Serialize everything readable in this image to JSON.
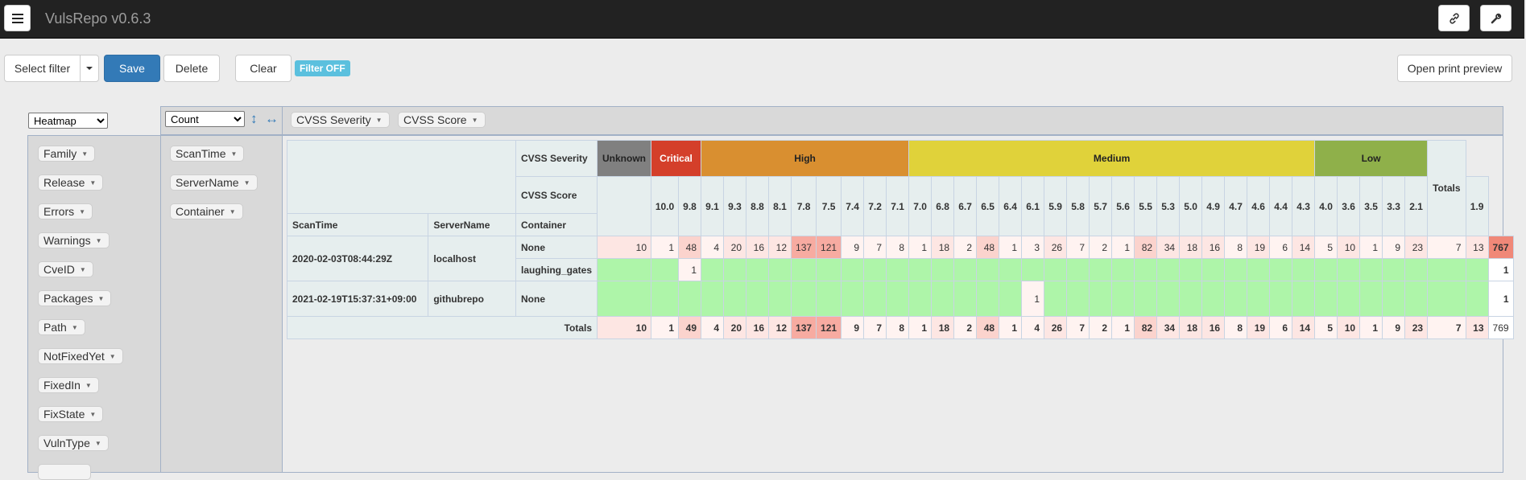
{
  "app": {
    "title": "VulsRepo v0.6.3"
  },
  "toolbar": {
    "select_filter": "Select filter",
    "save": "Save",
    "delete": "Delete",
    "clear": "Clear",
    "filter_status": "Filter OFF",
    "print_preview": "Open print preview"
  },
  "pivot": {
    "renderer": "Heatmap",
    "aggregator": "Count",
    "col_attrs": [
      "CVSS Severity",
      "CVSS Score"
    ],
    "unused_attrs": [
      "Family",
      "Release",
      "Errors",
      "Warnings",
      "CveID",
      "Packages",
      "Path",
      "NotFixedYet",
      "FixedIn",
      "FixState",
      "VulnType"
    ],
    "row_attrs": [
      "ScanTime",
      "ServerName",
      "Container"
    ]
  },
  "table": {
    "header_labels": {
      "cvss_severity": "CVSS Severity",
      "cvss_score": "CVSS Score",
      "totals": "Totals",
      "scan_time": "ScanTime",
      "server_name": "ServerName",
      "container": "Container"
    },
    "severity_groups": [
      {
        "label": "Unknown",
        "span": 1,
        "color": "#808080"
      },
      {
        "label": "Critical",
        "span": 2,
        "color": "#d43f2a"
      },
      {
        "label": "High",
        "span": 9,
        "color": "#d98f30"
      },
      {
        "label": "Medium",
        "span": 18,
        "color": "#e0d23a"
      },
      {
        "label": "Low",
        "span": 5,
        "color": "#8fb04a"
      }
    ],
    "scores": [
      "",
      "10.0",
      "9.8",
      "9.1",
      "9.3",
      "8.8",
      "8.1",
      "7.8",
      "7.5",
      "7.4",
      "7.2",
      "7.1",
      "7.0",
      "6.8",
      "6.7",
      "6.5",
      "6.4",
      "6.1",
      "5.9",
      "5.8",
      "5.7",
      "5.6",
      "5.5",
      "5.3",
      "5.0",
      "4.9",
      "4.7",
      "4.6",
      "4.4",
      "4.3",
      "4.0",
      "3.6",
      "3.5",
      "3.3",
      "2.1",
      "1.9"
    ],
    "rows": [
      {
        "scan_time": "2020-02-03T08:44:29Z",
        "server": "localhost",
        "container": "None",
        "values": [
          10,
          1,
          48,
          4,
          20,
          16,
          12,
          137,
          121,
          9,
          7,
          8,
          1,
          18,
          2,
          48,
          1,
          3,
          26,
          7,
          2,
          1,
          82,
          34,
          18,
          16,
          8,
          19,
          6,
          14,
          5,
          10,
          1,
          9,
          23,
          7,
          13
        ],
        "total": "767"
      },
      {
        "container": "laughing_gates",
        "values": [
          null,
          null,
          1,
          null,
          null,
          null,
          null,
          null,
          null,
          null,
          null,
          null,
          null,
          null,
          null,
          null,
          null,
          null,
          null,
          null,
          null,
          null,
          null,
          null,
          null,
          null,
          null,
          null,
          null,
          null,
          null,
          null,
          null,
          null,
          null,
          null,
          null
        ],
        "total": "1"
      },
      {
        "scan_time": "2021-02-19T15:37:31+09:00",
        "server": "githubrepo",
        "container": "None",
        "values": [
          null,
          null,
          null,
          null,
          null,
          null,
          null,
          null,
          null,
          null,
          null,
          null,
          null,
          null,
          null,
          null,
          null,
          1,
          null,
          null,
          null,
          null,
          null,
          null,
          null,
          null,
          null,
          null,
          null,
          null,
          null,
          null,
          null,
          null,
          null,
          null,
          null
        ],
        "total": "1"
      }
    ],
    "col_totals": [
      10,
      1,
      49,
      4,
      20,
      16,
      12,
      137,
      121,
      9,
      7,
      8,
      1,
      18,
      2,
      48,
      1,
      4,
      26,
      7,
      2,
      1,
      82,
      34,
      18,
      16,
      8,
      19,
      6,
      14,
      5,
      10,
      1,
      9,
      23,
      7,
      13
    ],
    "grand_total": "769",
    "heat_colors": {
      "none": "#ffffff",
      "faint": "#fff3f1",
      "light": "#fde6e3",
      "medium": "#fbd3cd",
      "strong": "#f7aba1",
      "max": "#f08878",
      "empty": "#aef5a9"
    }
  }
}
